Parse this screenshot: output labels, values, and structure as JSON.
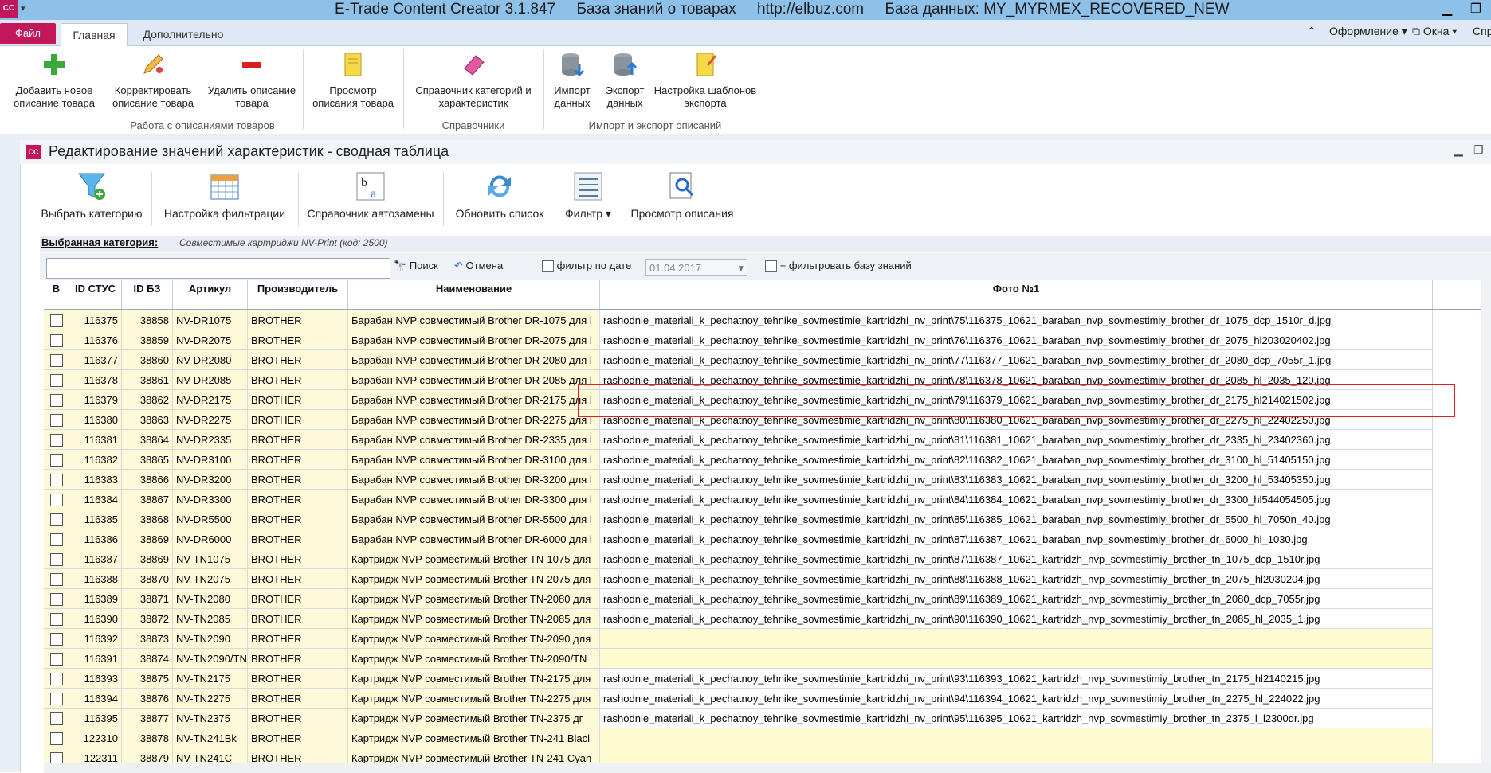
{
  "window": {
    "app_icon": "CC",
    "title": "E-Trade Content Creator 3.1.847     База знаний о товарах     http://elbuz.com     База данных: MY_MYRMEX_RECOVERED_NEW",
    "minimize_icon": "minimize-icon",
    "restore_icon": "restore-icon"
  },
  "menu": {
    "file": "Файл",
    "tabs": [
      "Главная",
      "Дополнительно"
    ],
    "right_items": [
      "Оформление",
      "Окна",
      "Спр"
    ]
  },
  "ribbon": {
    "buttons": [
      {
        "label": "Добавить новое описание товара",
        "icon": "plus-icon"
      },
      {
        "label": "Корректировать описание товара",
        "icon": "pencil-icon"
      },
      {
        "label": "Удалить описание товара",
        "icon": "minus-icon"
      },
      {
        "label": "Просмотр описания товара",
        "icon": "document-icon"
      },
      {
        "label": "Справочник категорий и характеристик",
        "icon": "eraser-icon"
      },
      {
        "label": "Импорт данных",
        "icon": "database-import-icon"
      },
      {
        "label": "Экспорт данных",
        "icon": "database-export-icon"
      },
      {
        "label": "Настройка шаблонов экспорта",
        "icon": "template-icon"
      }
    ],
    "groups": [
      "Работа с описаниями товаров",
      "Справочники",
      "Импорт и экспорт описаний"
    ]
  },
  "child": {
    "icon": "CC",
    "title": "Редактирование значений характеристик - сводная таблица"
  },
  "toolbar": {
    "buttons": [
      {
        "label": "Выбрать категорию",
        "icon": "funnel-add-icon"
      },
      {
        "label": "Настройка фильтрации",
        "icon": "calendar-grid-icon"
      },
      {
        "label": "Справочник автозамены",
        "icon": "replace-ab-icon"
      },
      {
        "label": "Обновить список",
        "icon": "refresh-icon"
      },
      {
        "label": "Фильтр",
        "icon": "filter-list-icon"
      },
      {
        "label": "Просмотр описания",
        "icon": "preview-icon"
      }
    ]
  },
  "category": {
    "label": "Выбранная категория:",
    "value": "Совместимые картриджи NV-Print (код: 2500)"
  },
  "filter": {
    "search_value": "",
    "search_button": "Поиск",
    "cancel_button": "Отмена",
    "date_filter_label": "фильтр по дате",
    "date_value": "01.04.2017",
    "knowledge_filter_label": "+ фильтровать базу знаний"
  },
  "grid": {
    "columns": [
      "B",
      "ID СТУС",
      "ID БЗ",
      "Артикул",
      "Производитель",
      "Наименование",
      "Фото №1"
    ],
    "rows": [
      [
        "116375",
        "38858",
        "NV-DR1075",
        "BROTHER",
        "Барабан NVP совместимый Brother DR-1075 для l",
        "rashodnie_materiali_k_pechatnoy_tehnike_sovmestimie_kartridzhi_nv_print\\75\\116375_10621_baraban_nvp_sovmestimiy_brother_dr_1075_dcp_1510r_d.jpg"
      ],
      [
        "116376",
        "38859",
        "NV-DR2075",
        "BROTHER",
        "Барабан NVP совместимый Brother DR-2075 для l",
        "rashodnie_materiali_k_pechatnoy_tehnike_sovmestimie_kartridzhi_nv_print\\76\\116376_10621_baraban_nvp_sovmestimiy_brother_dr_2075_hl203020402.jpg"
      ],
      [
        "116377",
        "38860",
        "NV-DR2080",
        "BROTHER",
        "Барабан NVP совместимый Brother DR-2080 для l",
        "rashodnie_materiali_k_pechatnoy_tehnike_sovmestimie_kartridzhi_nv_print\\77\\116377_10621_baraban_nvp_sovmestimiy_brother_dr_2080_dcp_7055r_1.jpg"
      ],
      [
        "116378",
        "38861",
        "NV-DR2085",
        "BROTHER",
        "Барабан NVP совместимый Brother DR-2085 для l",
        "rashodnie_materiali_k_pechatnoy_tehnike_sovmestimie_kartridzhi_nv_print\\78\\116378_10621_baraban_nvp_sovmestimiy_brother_dr_2085_hl_2035_120.jpg"
      ],
      [
        "116379",
        "38862",
        "NV-DR2175",
        "BROTHER",
        "Барабан NVP совместимый Brother DR-2175 для l",
        "rashodnie_materiali_k_pechatnoy_tehnike_sovmestimie_kartridzhi_nv_print\\79\\116379_10621_baraban_nvp_sovmestimiy_brother_dr_2175_hl214021502.jpg"
      ],
      [
        "116380",
        "38863",
        "NV-DR2275",
        "BROTHER",
        "Барабан NVP совместимый Brother DR-2275 для l",
        "rashodnie_materiali_k_pechatnoy_tehnike_sovmestimie_kartridzhi_nv_print\\80\\116380_10621_baraban_nvp_sovmestimiy_brother_dr_2275_hl_22402250.jpg"
      ],
      [
        "116381",
        "38864",
        "NV-DR2335",
        "BROTHER",
        "Барабан NVP совместимый Brother DR-2335 для l",
        "rashodnie_materiali_k_pechatnoy_tehnike_sovmestimie_kartridzhi_nv_print\\81\\116381_10621_baraban_nvp_sovmestimiy_brother_dr_2335_hl_23402360.jpg"
      ],
      [
        "116382",
        "38865",
        "NV-DR3100",
        "BROTHER",
        "Барабан NVP совместимый Brother DR-3100 для l",
        "rashodnie_materiali_k_pechatnoy_tehnike_sovmestimie_kartridzhi_nv_print\\82\\116382_10621_baraban_nvp_sovmestimiy_brother_dr_3100_hl_51405150.jpg"
      ],
      [
        "116383",
        "38866",
        "NV-DR3200",
        "BROTHER",
        "Барабан NVP совместимый Brother DR-3200 для l",
        "rashodnie_materiali_k_pechatnoy_tehnike_sovmestimie_kartridzhi_nv_print\\83\\116383_10621_baraban_nvp_sovmestimiy_brother_dr_3200_hl_53405350.jpg"
      ],
      [
        "116384",
        "38867",
        "NV-DR3300",
        "BROTHER",
        "Барабан NVP совместимый Brother DR-3300 для l",
        "rashodnie_materiali_k_pechatnoy_tehnike_sovmestimie_kartridzhi_nv_print\\84\\116384_10621_baraban_nvp_sovmestimiy_brother_dr_3300_hl544054505.jpg"
      ],
      [
        "116385",
        "38868",
        "NV-DR5500",
        "BROTHER",
        "Барабан NVP совместимый Brother DR-5500 для l",
        "rashodnie_materiali_k_pechatnoy_tehnike_sovmestimie_kartridzhi_nv_print\\85\\116385_10621_baraban_nvp_sovmestimiy_brother_dr_5500_hl_7050n_40.jpg"
      ],
      [
        "116386",
        "38869",
        "NV-DR6000",
        "BROTHER",
        "Барабан NVP совместимый Brother DR-6000 для l",
        "rashodnie_materiali_k_pechatnoy_tehnike_sovmestimie_kartridzhi_nv_print\\87\\116387_10621_baraban_nvp_sovmestimiy_brother_dr_6000_hl_1030.jpg"
      ],
      [
        "116387",
        "38869",
        "NV-TN1075",
        "BROTHER",
        "Картридж NVP совместимый Brother TN-1075 для",
        "rashodnie_materiali_k_pechatnoy_tehnike_sovmestimie_kartridzhi_nv_print\\87\\116387_10621_kartridzh_nvp_sovmestimiy_brother_tn_1075_dcp_1510r.jpg"
      ],
      [
        "116388",
        "38870",
        "NV-TN2075",
        "BROTHER",
        "Картридж NVP совместимый Brother TN-2075 для",
        "rashodnie_materiali_k_pechatnoy_tehnike_sovmestimie_kartridzhi_nv_print\\88\\116388_10621_kartridzh_nvp_sovmestimiy_brother_tn_2075_hl2030204.jpg"
      ],
      [
        "116389",
        "38871",
        "NV-TN2080",
        "BROTHER",
        "Картридж NVP совместимый Brother TN-2080 для",
        "rashodnie_materiali_k_pechatnoy_tehnike_sovmestimie_kartridzhi_nv_print\\89\\116389_10621_kartridzh_nvp_sovmestimiy_brother_tn_2080_dcp_7055r.jpg"
      ],
      [
        "116390",
        "38872",
        "NV-TN2085",
        "BROTHER",
        "Картридж NVP совместимый Brother TN-2085 для",
        "rashodnie_materiali_k_pechatnoy_tehnike_sovmestimie_kartridzhi_nv_print\\90\\116390_10621_kartridzh_nvp_sovmestimiy_brother_tn_2085_hl_2035_1.jpg"
      ],
      [
        "116392",
        "38873",
        "NV-TN2090",
        "BROTHER",
        "Картридж NVP совместимый Brother TN-2090 для",
        ""
      ],
      [
        "116391",
        "38874",
        "NV-TN2090/TN",
        "BROTHER",
        "Картридж NVP совместимый Brother TN-2090/TN",
        ""
      ],
      [
        "116393",
        "38875",
        "NV-TN2175",
        "BROTHER",
        "Картридж NVP совместимый Brother TN-2175 для",
        "rashodnie_materiali_k_pechatnoy_tehnike_sovmestimie_kartridzhi_nv_print\\93\\116393_10621_kartridzh_nvp_sovmestimiy_brother_tn_2175_hl2140215.jpg"
      ],
      [
        "116394",
        "38876",
        "NV-TN2275",
        "BROTHER",
        "Картридж NVP совместимый Brother TN-2275 для",
        "rashodnie_materiali_k_pechatnoy_tehnike_sovmestimie_kartridzhi_nv_print\\94\\116394_10621_kartridzh_nvp_sovmestimiy_brother_tn_2275_hl_224022.jpg"
      ],
      [
        "116395",
        "38877",
        "NV-TN2375",
        "BROTHER",
        "Картридж NVP совместимый Brother TN-2375 дг",
        "rashodnie_materiali_k_pechatnoy_tehnike_sovmestimie_kartridzhi_nv_print\\95\\116395_10621_kartridzh_nvp_sovmestimiy_brother_tn_2375_l_l2300dr.jpg"
      ],
      [
        "122310",
        "38878",
        "NV-TN241Bk",
        "BROTHER",
        "Картридж NVP совместимый Brother TN-241 Blacl",
        ""
      ],
      [
        "122311",
        "38879",
        "NV-TN241C",
        "BROTHER",
        "Картридж NVP совместимый Brother TN-241 Cyan",
        ""
      ]
    ]
  },
  "colors": {
    "accent": "#c2185b",
    "titlebar": "#8ec1ea",
    "row_bg": "#fdf8d8",
    "highlight": "#e02020"
  }
}
